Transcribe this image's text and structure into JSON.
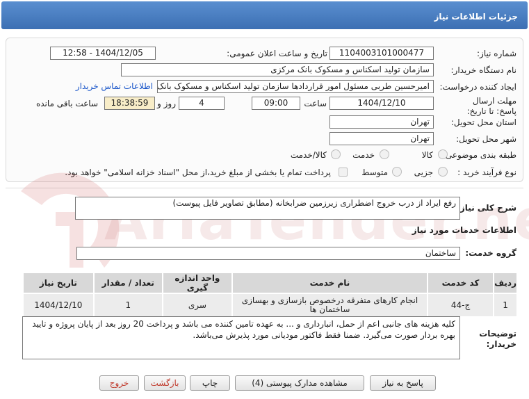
{
  "header": {
    "title": "جزئیات اطلاعات نیاز"
  },
  "form": {
    "need_number_label": "شماره نیاز:",
    "need_number": "1104003101000477",
    "announce_label": "تاریخ و ساعت اعلان عمومی:",
    "announce_value": "1404/12/05 - 12:58",
    "buyer_org_label": "نام دستگاه خریدار:",
    "buyer_org": "سازمان تولید اسکناس و مسکوک بانک مرکزی",
    "creator_label": "ایجاد کننده درخواست:",
    "creator": "امیرحسین طربی مسئول امور قراردادها سازمان تولید اسکناس و مسکوک بانک مرکزی",
    "contact_link": "اطلاعات تماس خریدار",
    "deadline_label": "مهلت ارسال پاسخ: تا تاریخ:",
    "deadline_date": "1404/12/10",
    "time_label": "ساعت",
    "deadline_time": "09:00",
    "days_value": "4",
    "days_label": "روز و",
    "remaining_time": "18:38:59",
    "remaining_label": "ساعت باقی مانده",
    "province_label": "استان محل تحویل:",
    "province": "تهران",
    "city_label": "شهر محل تحویل:",
    "city": "تهران",
    "category_label": "طبقه بندی موضوعی:",
    "category_options": [
      "کالا",
      "خدمت",
      "کالا/خدمت"
    ],
    "process_label": "نوع فرآیند خرید :",
    "process_options": [
      "جزیی",
      "متوسط"
    ],
    "payment_note": "پرداخت تمام یا بخشی از مبلغ خرید،از محل \"اسناد خزانه اسلامی\" خواهد بود."
  },
  "description": {
    "label": "شرح کلی نیاز:",
    "value": "رفع ایراد از درب خروج اضطراری زیرزمین ضرابخانه (مطابق تصاویر فایل پیوست)"
  },
  "services": {
    "section_title": "اطلاعات خدمات مورد نیاز",
    "group_label": "گروه خدمت:",
    "group_value": "ساختمان",
    "columns": [
      "ردیف",
      "کد خدمت",
      "نام خدمت",
      "واحد اندازه گیری",
      "تعداد / مقدار",
      "تاریخ نیاز"
    ],
    "rows": [
      {
        "row": "1",
        "code": "ج-44",
        "name": "انجام کارهای متفرقه درخصوص بازسازی و بهسازی ساختمان ها",
        "unit": "سری",
        "qty": "1",
        "date": "1404/12/10"
      }
    ]
  },
  "buyer_notes": {
    "label": "توضیحات خریدار:",
    "value": "کلیه هزینه های جانبی اعم از حمل، انبارداری و ... به عهده تامین کننده می باشد و پرداخت 20 روز بعد از پایان پروژه و تایید بهره بردار صورت می‌گیرد. ضمنا فقط فاکتور مودیانی مورد پذیرش می‌باشد."
  },
  "buttons": {
    "reply": "پاسخ به نیاز",
    "documents": "مشاهده مدارک پیوستی (4)",
    "print": "چاپ",
    "back": "بازگشت",
    "exit": "خروج"
  },
  "watermark": {
    "text": "AriaTender.net"
  },
  "colors": {
    "header": "#3c6fb3",
    "link": "#1a56c9",
    "exit_text": "#c0392b",
    "remaining_bg": "#f8edc8"
  }
}
